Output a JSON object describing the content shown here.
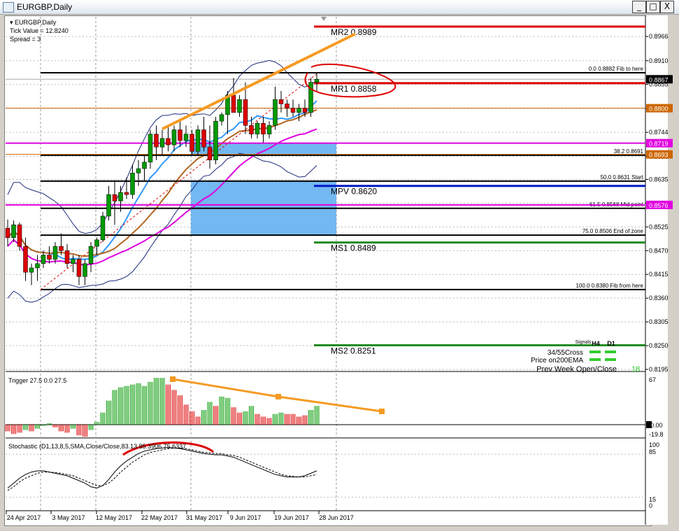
{
  "window": {
    "title": "EURGBP,Daily",
    "minimize_glyph": "_",
    "restore_glyph": "□",
    "close_glyph": "X"
  },
  "chart_info": {
    "symbol_line": "EURGBP,Daily",
    "tick_value": "Tick Value = 12.8240",
    "spread": "Spread = 3"
  },
  "colors": {
    "bull": "#009900",
    "bear": "#dd0000",
    "fib_zone": "#5aacef",
    "orange": "#f59a23",
    "magenta": "#e000e0",
    "blue_line": "#0018c8",
    "red_level": "#dd0000",
    "green_level": "#228b22"
  },
  "chart_data": [
    {
      "type": "candlestick",
      "symbol": "EURGBP",
      "timeframe": "Daily",
      "ylim": [
        0.8195,
        0.8989
      ],
      "x_ticks": [
        "24 Apr 2017",
        "3 May 2017",
        "12 May 2017",
        "22 May 2017",
        "31 May 2017",
        "9 Jun 2017",
        "19 Jun 2017",
        "28 Jun 2017"
      ],
      "y_ticks": [
        "0.8966",
        "0.8910",
        "0.8855",
        "0.8799",
        "0.8744",
        "0.8688",
        "0.8635",
        "0.8580",
        "0.8525",
        "0.8470",
        "0.8415",
        "0.8360",
        "0.8305",
        "0.8250",
        "0.8195"
      ],
      "candles": [
        [
          0.8522,
          0.8542,
          0.848,
          0.85
        ],
        [
          0.85,
          0.854,
          0.849,
          0.853
        ],
        [
          0.853,
          0.8535,
          0.847,
          0.848
        ],
        [
          0.848,
          0.85,
          0.84,
          0.842
        ],
        [
          0.842,
          0.844,
          0.839,
          0.843
        ],
        [
          0.843,
          0.846,
          0.84,
          0.844
        ],
        [
          0.844,
          0.847,
          0.843,
          0.846
        ],
        [
          0.846,
          0.848,
          0.844,
          0.845
        ],
        [
          0.845,
          0.849,
          0.844,
          0.848
        ],
        [
          0.848,
          0.851,
          0.846,
          0.847
        ],
        [
          0.847,
          0.8485,
          0.843,
          0.844
        ],
        [
          0.844,
          0.846,
          0.842,
          0.845
        ],
        [
          0.845,
          0.846,
          0.839,
          0.841
        ],
        [
          0.841,
          0.845,
          0.839,
          0.844
        ],
        [
          0.844,
          0.849,
          0.842,
          0.848
        ],
        [
          0.848,
          0.85,
          0.846,
          0.8495
        ],
        [
          0.8495,
          0.856,
          0.849,
          0.855
        ],
        [
          0.855,
          0.862,
          0.854,
          0.86
        ],
        [
          0.86,
          0.863,
          0.853,
          0.8585
        ],
        [
          0.8585,
          0.862,
          0.856,
          0.8605
        ],
        [
          0.8605,
          0.864,
          0.859,
          0.86
        ],
        [
          0.86,
          0.867,
          0.859,
          0.865
        ],
        [
          0.865,
          0.868,
          0.862,
          0.866
        ],
        [
          0.866,
          0.869,
          0.863,
          0.8675
        ],
        [
          0.8675,
          0.875,
          0.866,
          0.874
        ],
        [
          0.874,
          0.876,
          0.868,
          0.871
        ],
        [
          0.871,
          0.875,
          0.869,
          0.873
        ],
        [
          0.873,
          0.876,
          0.87,
          0.8715
        ],
        [
          0.8715,
          0.876,
          0.87,
          0.875
        ],
        [
          0.875,
          0.877,
          0.871,
          0.8725
        ],
        [
          0.8725,
          0.876,
          0.871,
          0.874
        ],
        [
          0.874,
          0.875,
          0.869,
          0.87
        ],
        [
          0.87,
          0.876,
          0.869,
          0.875
        ],
        [
          0.875,
          0.878,
          0.87,
          0.871
        ],
        [
          0.871,
          0.876,
          0.866,
          0.868
        ],
        [
          0.868,
          0.878,
          0.867,
          0.877
        ],
        [
          0.877,
          0.879,
          0.876,
          0.8785
        ],
        [
          0.8785,
          0.884,
          0.874,
          0.883
        ],
        [
          0.883,
          0.887,
          0.88,
          0.879
        ],
        [
          0.879,
          0.883,
          0.878,
          0.882
        ],
        [
          0.882,
          0.886,
          0.874,
          0.876
        ],
        [
          0.876,
          0.878,
          0.873,
          0.874
        ],
        [
          0.874,
          0.877,
          0.873,
          0.8765
        ],
        [
          0.8765,
          0.878,
          0.872,
          0.874
        ],
        [
          0.874,
          0.877,
          0.873,
          0.876
        ],
        [
          0.876,
          0.885,
          0.875,
          0.882
        ],
        [
          0.882,
          0.884,
          0.879,
          0.881
        ],
        [
          0.881,
          0.882,
          0.878,
          0.88
        ],
        [
          0.88,
          0.882,
          0.878,
          0.879
        ],
        [
          0.879,
          0.881,
          0.877,
          0.88
        ],
        [
          0.88,
          0.882,
          0.878,
          0.879
        ],
        [
          0.879,
          0.887,
          0.878,
          0.886
        ],
        [
          0.886,
          0.888,
          0.884,
          0.8867
        ]
      ],
      "price_tags": [
        {
          "value": "0.8867",
          "color": "#000000"
        },
        {
          "value": "0.8800",
          "color": "#cc6600"
        },
        {
          "value": "0.8719",
          "color": "#e000e0"
        },
        {
          "value": "0.8693",
          "color": "#cc6600"
        },
        {
          "value": "0.8576",
          "color": "#e000e0"
        }
      ],
      "pivots": [
        {
          "label": "MR2",
          "value": "0.8989",
          "color": "#dd0000"
        },
        {
          "label": "MR1",
          "value": "0.8858",
          "color": "#dd0000"
        },
        {
          "label": "MPV",
          "value": "0.8620",
          "color": "#0018c8"
        },
        {
          "label": "MS1",
          "value": "0.8489",
          "color": "#228b22"
        },
        {
          "label": "MS2",
          "value": "0.8251",
          "color": "#228b22"
        }
      ],
      "fib_levels": [
        {
          "pct": "0.0",
          "value": "0.8882",
          "note": "Fib to here"
        },
        {
          "pct": "38.2",
          "value": "0.8691",
          "note": ""
        },
        {
          "pct": "50.0",
          "value": "0.8631",
          "note": "Start"
        },
        {
          "pct": "61.5",
          "value": "0.8568",
          "note": "Mid point"
        },
        {
          "pct": "75.0",
          "value": "0.8506",
          "note": "End of zone"
        },
        {
          "pct": "100.0",
          "value": "0.8380",
          "note": "Fib from here"
        }
      ],
      "signals_panel": {
        "title": "Signals",
        "columns": [
          "H4",
          "D1"
        ],
        "rows": [
          {
            "label": "34/55Cross",
            "h4": "bull",
            "d1": "bull"
          },
          {
            "label": "Price on200EMA",
            "h4": "bull",
            "d1": "bull"
          },
          {
            "label": "Prev Week Open/Close",
            "value": "18"
          }
        ]
      }
    },
    {
      "type": "bar",
      "indicator": "Trigger",
      "label": "Trigger 27.5 0.0 27.5",
      "y_ticks": [
        "67",
        "0.00",
        "-19.8"
      ],
      "values": [
        -10,
        -14,
        -12,
        -8,
        -10,
        -6,
        -2,
        2,
        -4,
        -10,
        -12,
        -6,
        -16,
        -18,
        -8,
        4,
        18,
        36,
        52,
        56,
        58,
        60,
        62,
        58,
        64,
        70,
        70,
        60,
        52,
        44,
        30,
        20,
        12,
        22,
        34,
        28,
        42,
        40,
        26,
        18,
        20,
        28,
        16,
        12,
        10,
        16,
        18,
        16,
        16,
        12,
        14,
        22,
        28
      ],
      "colors": [
        "r",
        "r",
        "r",
        "g",
        "r",
        "g",
        "g",
        "g",
        "r",
        "r",
        "r",
        "g",
        "r",
        "r",
        "g",
        "g",
        "g",
        "g",
        "g",
        "g",
        "g",
        "g",
        "g",
        "g",
        "g",
        "g",
        "g",
        "r",
        "r",
        "r",
        "r",
        "r",
        "r",
        "g",
        "g",
        "r",
        "g",
        "g",
        "r",
        "r",
        "g",
        "g",
        "r",
        "r",
        "r",
        "g",
        "g",
        "r",
        "r",
        "r",
        "r",
        "g",
        "g"
      ]
    },
    {
      "type": "line",
      "indicator": "Stochastic",
      "label": "Stochastic (D1,13,8,5,SMA,Close/Close,83.13 85.3906 75.6337",
      "y_ticks": [
        "100",
        "85",
        "15",
        "0"
      ],
      "series": [
        {
          "name": "main",
          "values": [
            30,
            38,
            46,
            52,
            56,
            58,
            58,
            56,
            54,
            52,
            50,
            46,
            42,
            38,
            32,
            30,
            34,
            44,
            56,
            66,
            74,
            80,
            86,
            90,
            92,
            94,
            95,
            96,
            95,
            94,
            92,
            90,
            88,
            86,
            85,
            84,
            84,
            82,
            80,
            76,
            72,
            68,
            64,
            60,
            56,
            52,
            50,
            48,
            48,
            48,
            50,
            54,
            58
          ]
        },
        {
          "name": "signal",
          "values": [
            26,
            32,
            40,
            46,
            50,
            54,
            56,
            56,
            55,
            54,
            52,
            50,
            46,
            42,
            38,
            34,
            34,
            38,
            46,
            56,
            64,
            72,
            78,
            84,
            88,
            90,
            92,
            94,
            95,
            95,
            94,
            92,
            90,
            88,
            87,
            86,
            86,
            84,
            83,
            80,
            76,
            72,
            68,
            64,
            60,
            56,
            52,
            50,
            49,
            48,
            48,
            50,
            52
          ]
        }
      ]
    }
  ]
}
